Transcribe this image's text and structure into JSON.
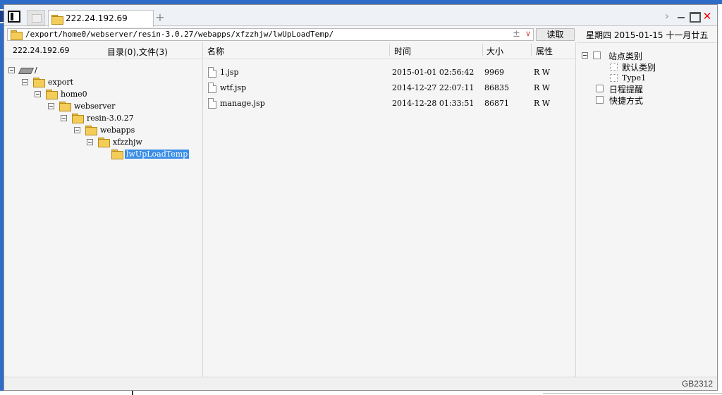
{
  "tabs": [
    {
      "label": "222.24.192.69",
      "active": true
    }
  ],
  "tab_add_label": "+",
  "window_controls": {
    "next": "›",
    "close": "✕"
  },
  "address": {
    "path": "/export/home0/webserver/resin-3.0.27/webapps/xfzzhjw/lwUpLoadTemp/",
    "plus": "±",
    "chevron": "∨",
    "read_button": "读取"
  },
  "tree": {
    "server": "222.24.192.69",
    "counts": "目录(0),文件(3)",
    "nodes": [
      {
        "label": "/",
        "depth": 0,
        "type": "drive",
        "expanded": true,
        "selected": false
      },
      {
        "label": "export",
        "depth": 1,
        "type": "folder",
        "expanded": true,
        "selected": false
      },
      {
        "label": "home0",
        "depth": 2,
        "type": "folder",
        "expanded": true,
        "selected": false
      },
      {
        "label": "webserver",
        "depth": 3,
        "type": "folder",
        "expanded": true,
        "selected": false
      },
      {
        "label": "resin-3.0.27",
        "depth": 4,
        "type": "folder",
        "expanded": true,
        "selected": false
      },
      {
        "label": "webapps",
        "depth": 5,
        "type": "folder",
        "expanded": true,
        "selected": false
      },
      {
        "label": "xfzzhjw",
        "depth": 6,
        "type": "folder",
        "expanded": true,
        "selected": false
      },
      {
        "label": "lwUpLoadTemp",
        "depth": 7,
        "type": "folder",
        "expanded": false,
        "selected": true
      }
    ]
  },
  "file_list": {
    "columns": {
      "name": "名称",
      "time": "时间",
      "size": "大小",
      "attr": "属性"
    },
    "rows": [
      {
        "name": "1.jsp",
        "time": "2015-01-01 02:56:42",
        "size": "9969",
        "attr": "R W"
      },
      {
        "name": "wtf.jsp",
        "time": "2014-12-27 22:07:11",
        "size": "86835",
        "attr": "R W"
      },
      {
        "name": "manage.jsp",
        "time": "2014-12-28 01:33:51",
        "size": "86871",
        "attr": "R W"
      }
    ]
  },
  "sidebar": {
    "date": "星期四 2015-01-15 十一月廿五",
    "site_category": "站点类别",
    "category_items": [
      "默认类别",
      "Type1"
    ],
    "schedule": "日程提醒",
    "shortcuts": "快捷方式"
  },
  "status": {
    "encoding": "GB2312"
  }
}
